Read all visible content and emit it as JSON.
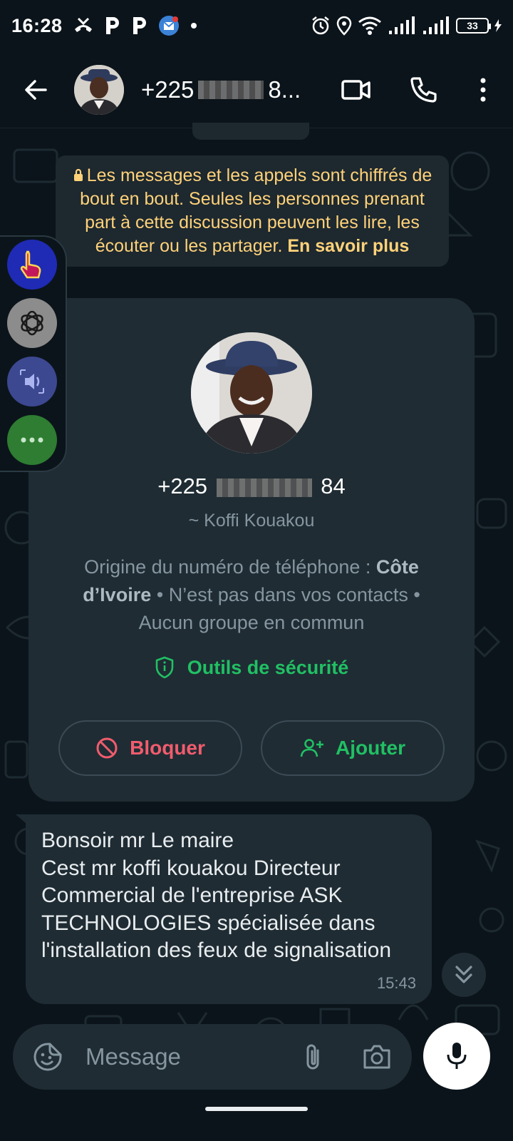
{
  "status_bar": {
    "time": "16:28",
    "battery": "33"
  },
  "header": {
    "title_prefix": "+225",
    "title_suffix": "8..."
  },
  "encryption_notice": {
    "text": "Les messages et les appels sont chiffrés de bout en bout. Seules les personnes prenant part à cette discussion peuvent les lire, les écouter ou les partager.",
    "link": "En savoir plus"
  },
  "contact_card": {
    "phone_prefix": "+225",
    "phone_suffix": "84",
    "name": "~ Koffi Kouakou",
    "origin_label": "Origine du numéro de téléphone :",
    "origin_country": "Côte d’Ivoire",
    "details": "• N’est pas dans vos contacts • Aucun groupe en commun",
    "security_label": "Outils de sécurité",
    "block_label": "Bloquer",
    "add_label": "Ajouter"
  },
  "message": {
    "text": "Bonsoir mr Le maire\nCest mr koffi kouakou Directeur Commercial de l'entreprise  ASK TECHNOLOGIES spécialisée dans  l'installation  des feux de signalisation",
    "time": "15:43"
  },
  "composer": {
    "placeholder": "Message"
  },
  "colors": {
    "accent_green": "#21c063",
    "danger_red": "#f15c6d",
    "notice_yellow": "#ffd279",
    "bubble_bg": "#1f2c34",
    "app_bg": "#0b141a"
  }
}
